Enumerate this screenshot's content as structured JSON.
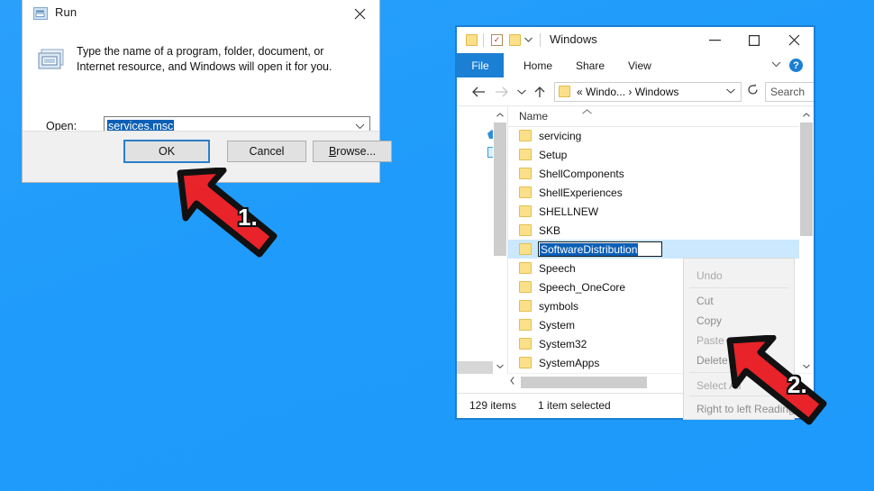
{
  "desktop": {
    "background_color": "#1f9bfb"
  },
  "run_dialog": {
    "title": "Run",
    "title_icon": "run-app-icon",
    "close_icon": "close-icon",
    "description": "Type the name of a program, folder, document, or Internet resource, and Windows will open it for you.",
    "description_icon": "run-glyph-icon",
    "open_label": "Open:",
    "open_label_accel": "O",
    "input_value": "services.msc",
    "input_placeholder": "",
    "combo_arrow_icon": "chevron-down-icon",
    "buttons": {
      "ok": "OK",
      "cancel": "Cancel",
      "browse": "Browse...",
      "browse_accel": "B"
    },
    "focus_color": "#2a7fc9",
    "selection_color": "#0b5fb5"
  },
  "explorer": {
    "title": "Windows",
    "border_color": "#1b7fd4",
    "quick_access": {
      "folder_icon": "folder-icon",
      "properties_icon": "properties-icon",
      "new_folder_icon": "new-folder-icon",
      "customize_icon": "chevron-down-icon"
    },
    "window_controls": {
      "minimize": "minimize-icon",
      "maximize": "maximize-icon",
      "close": "close-icon"
    },
    "ribbon": {
      "file_tab": "File",
      "tabs": [
        "Home",
        "Share",
        "View"
      ],
      "expand_icon": "chevron-down-icon",
      "help_label": "?"
    },
    "navbar": {
      "back_icon": "arrow-left-icon",
      "forward_icon": "arrow-right-icon",
      "recent_icon": "chevron-down-icon",
      "up_icon": "arrow-up-icon",
      "breadcrumb_folder_icon": "folder-icon",
      "breadcrumb": "« Windo...  ›  Windows",
      "breadcrumb_dropdown_icon": "chevron-down-icon",
      "refresh_icon": "refresh-icon",
      "search_placeholder": "Search"
    },
    "columns": {
      "name": "Name",
      "sort_icon": "sort-ascending-icon"
    },
    "rows": [
      {
        "name": "servicing",
        "icon": "folder-icon",
        "selected": false,
        "renaming": false
      },
      {
        "name": "Setup",
        "icon": "folder-icon",
        "selected": false,
        "renaming": false
      },
      {
        "name": "ShellComponents",
        "icon": "folder-icon",
        "selected": false,
        "renaming": false
      },
      {
        "name": "ShellExperiences",
        "icon": "folder-icon",
        "selected": false,
        "renaming": false
      },
      {
        "name": "SHELLNEW",
        "icon": "folder-icon",
        "selected": false,
        "renaming": false
      },
      {
        "name": "SKB",
        "icon": "folder-icon",
        "selected": false,
        "renaming": false
      },
      {
        "name": "SoftwareDistribution",
        "icon": "folder-icon",
        "selected": true,
        "renaming": true
      },
      {
        "name": "Speech",
        "icon": "folder-icon",
        "selected": false,
        "renaming": false
      },
      {
        "name": "Speech_OneCore",
        "icon": "folder-icon",
        "selected": false,
        "renaming": false
      },
      {
        "name": "symbols",
        "icon": "folder-icon",
        "selected": false,
        "renaming": false
      },
      {
        "name": "System",
        "icon": "folder-icon",
        "selected": false,
        "renaming": false
      },
      {
        "name": "System32",
        "icon": "folder-icon",
        "selected": false,
        "renaming": false
      },
      {
        "name": "SystemApps",
        "icon": "folder-icon",
        "selected": false,
        "renaming": false
      }
    ],
    "rename_value": "SoftwareDistribution",
    "scrollbars": {
      "up_icon": "chevron-up-icon",
      "down_icon": "chevron-down-icon",
      "left_icon": "chevron-left-icon"
    },
    "status": {
      "item_count": "129 items",
      "selection": "1 item selected"
    }
  },
  "context_menu": {
    "items": [
      {
        "label": "Undo",
        "enabled": false
      },
      {
        "label": "Cut",
        "enabled": true
      },
      {
        "label": "Copy",
        "enabled": true
      },
      {
        "label": "Paste",
        "enabled": false
      },
      {
        "label": "Delete",
        "enabled": true
      },
      {
        "label": "Select All",
        "enabled": false
      },
      {
        "label": "Right to left Reading order",
        "enabled": true
      }
    ]
  },
  "annotations": {
    "arrow_color": "#e8232a",
    "arrow_outline": "#111111",
    "step1": "1.",
    "step2": "2."
  }
}
